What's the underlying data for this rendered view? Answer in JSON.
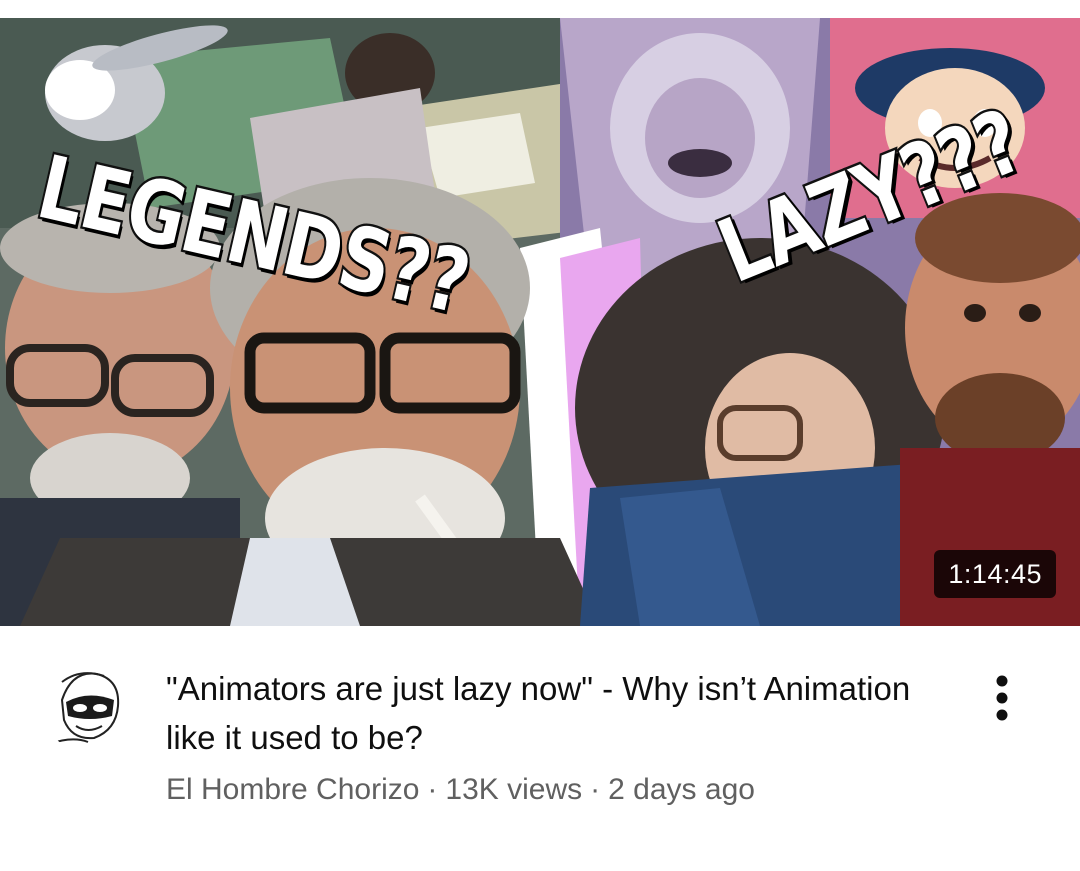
{
  "video": {
    "title": "\"Animators are just lazy now\" - Why isn’t Animation like it used to be?",
    "duration": "1:14:45",
    "thumbnail_text": {
      "left": "LEGENDS??",
      "right": "LAZY???"
    }
  },
  "channel": {
    "name": "El Hombre Chorizo",
    "avatar_icon": "masked-face-sketch-icon"
  },
  "stats": {
    "views": "13K views",
    "age": "2 days ago",
    "separator": "·"
  },
  "menu": {
    "icon": "more-vertical-icon"
  },
  "colors": {
    "title": "#0f0f0f",
    "meta": "#606060",
    "background": "#ffffff"
  }
}
